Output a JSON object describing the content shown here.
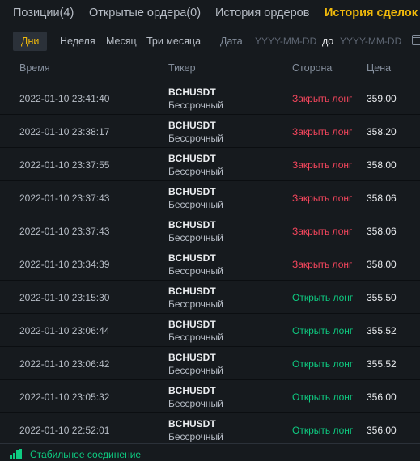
{
  "tabs": [
    {
      "label": "Позиции(4)",
      "active": false
    },
    {
      "label": "Открытые ордера(0)",
      "active": false
    },
    {
      "label": "История ордеров",
      "active": false
    },
    {
      "label": "История сделок",
      "active": true
    }
  ],
  "filters": {
    "periods": [
      "Дни",
      "Неделя",
      "Месяц",
      "Три месяца"
    ],
    "active_period": "Дни",
    "date_label": "Дата",
    "from_placeholder": "YYYY-MM-DD",
    "separator": "до",
    "to_placeholder": "YYYY-MM-DD",
    "calendar_icon": "calendar-icon"
  },
  "columns": {
    "time": "Время",
    "ticker": "Тикер",
    "side": "Сторона",
    "price": "Цена"
  },
  "trades": [
    {
      "time": "2022-01-10 23:41:40",
      "symbol": "BCHUSDT",
      "type": "Бессрочный",
      "side": "Закрыть лонг",
      "side_kind": "sell",
      "price": "359.00"
    },
    {
      "time": "2022-01-10 23:38:17",
      "symbol": "BCHUSDT",
      "type": "Бессрочный",
      "side": "Закрыть лонг",
      "side_kind": "sell",
      "price": "358.20"
    },
    {
      "time": "2022-01-10 23:37:55",
      "symbol": "BCHUSDT",
      "type": "Бессрочный",
      "side": "Закрыть лонг",
      "side_kind": "sell",
      "price": "358.00"
    },
    {
      "time": "2022-01-10 23:37:43",
      "symbol": "BCHUSDT",
      "type": "Бессрочный",
      "side": "Закрыть лонг",
      "side_kind": "sell",
      "price": "358.06"
    },
    {
      "time": "2022-01-10 23:37:43",
      "symbol": "BCHUSDT",
      "type": "Бессрочный",
      "side": "Закрыть лонг",
      "side_kind": "sell",
      "price": "358.06"
    },
    {
      "time": "2022-01-10 23:34:39",
      "symbol": "BCHUSDT",
      "type": "Бессрочный",
      "side": "Закрыть лонг",
      "side_kind": "sell",
      "price": "358.00"
    },
    {
      "time": "2022-01-10 23:15:30",
      "symbol": "BCHUSDT",
      "type": "Бессрочный",
      "side": "Открыть лонг",
      "side_kind": "buy",
      "price": "355.50"
    },
    {
      "time": "2022-01-10 23:06:44",
      "symbol": "BCHUSDT",
      "type": "Бессрочный",
      "side": "Открыть лонг",
      "side_kind": "buy",
      "price": "355.52"
    },
    {
      "time": "2022-01-10 23:06:42",
      "symbol": "BCHUSDT",
      "type": "Бессрочный",
      "side": "Открыть лонг",
      "side_kind": "buy",
      "price": "355.52"
    },
    {
      "time": "2022-01-10 23:05:32",
      "symbol": "BCHUSDT",
      "type": "Бессрочный",
      "side": "Открыть лонг",
      "side_kind": "buy",
      "price": "356.00"
    },
    {
      "time": "2022-01-10 22:52:01",
      "symbol": "BCHUSDT",
      "type": "Бессрочный",
      "side": "Открыть лонг",
      "side_kind": "buy",
      "price": "356.00"
    }
  ],
  "status": {
    "text": "Стабильное соединение",
    "icon": "signal-icon"
  },
  "colors": {
    "background": "#161a1e",
    "accent": "#f0b90b",
    "sell": "#f6465d",
    "buy": "#0ecb81"
  }
}
